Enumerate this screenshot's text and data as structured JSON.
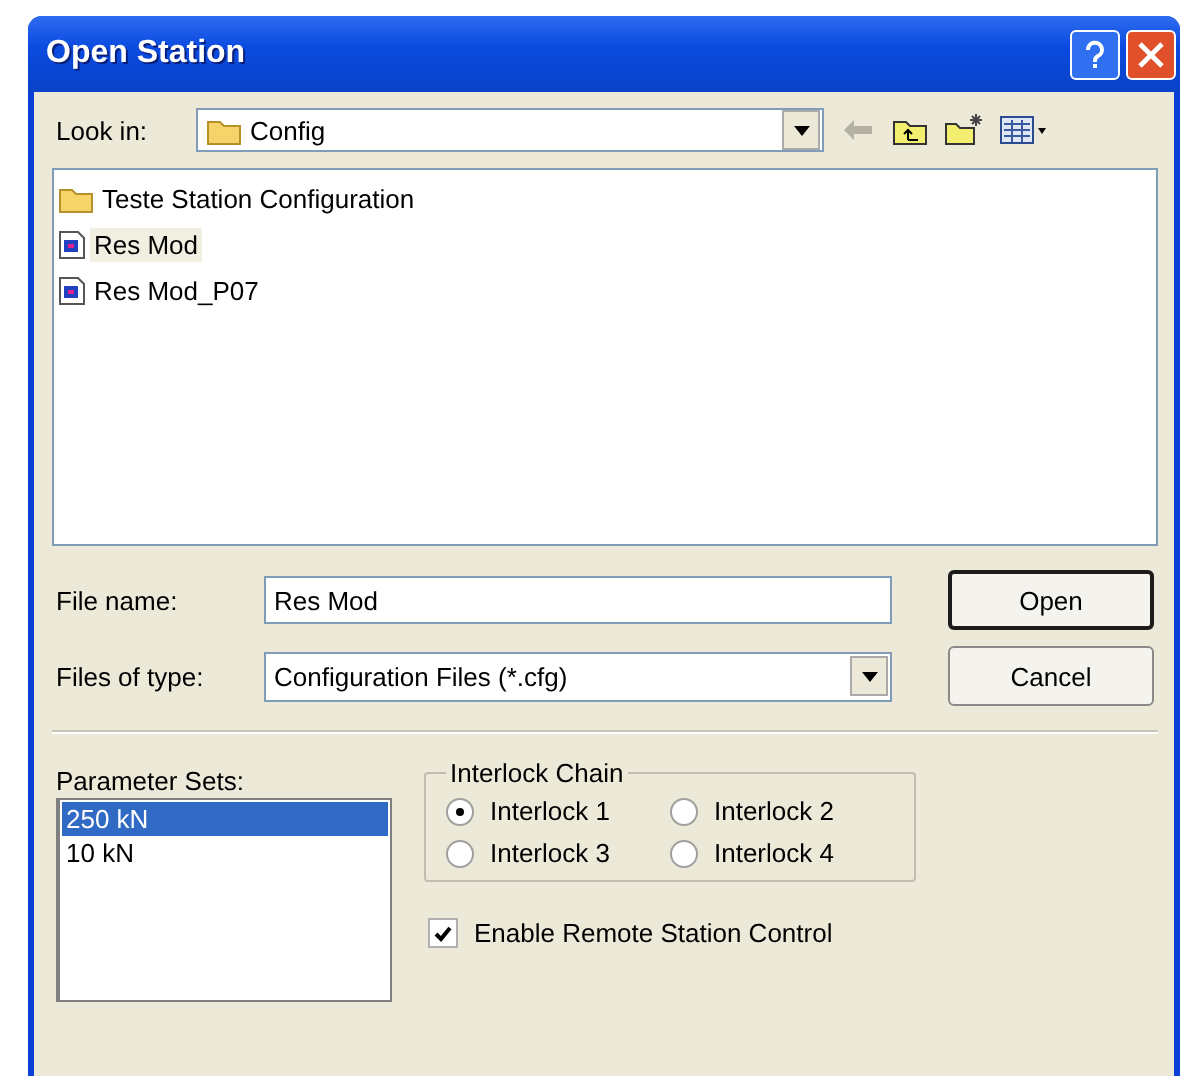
{
  "window": {
    "title": "Open Station"
  },
  "look_in": {
    "label": "Look in:",
    "value": "Config"
  },
  "files": [
    {
      "kind": "folder",
      "name": "Teste Station Configuration",
      "selected": false
    },
    {
      "kind": "file",
      "name": "Res Mod",
      "selected": true
    },
    {
      "kind": "file",
      "name": "Res Mod_P07",
      "selected": false
    }
  ],
  "file_name": {
    "label": "File name:",
    "value": "Res Mod"
  },
  "file_type": {
    "label": "Files of type:",
    "value": "Configuration Files (*.cfg)"
  },
  "buttons": [
    {
      "kind": "default",
      "label": "Open"
    },
    {
      "kind": "normal",
      "label": "Cancel"
    }
  ],
  "parameter_sets": {
    "label": "Parameter Sets:",
    "items": [
      {
        "name": "250 kN",
        "selected": true
      },
      {
        "name": "10 kN",
        "selected": false
      }
    ]
  },
  "interlock_chain": {
    "title": "Interlock Chain",
    "options": [
      {
        "label": "Interlock 1",
        "selected": true
      },
      {
        "label": "Interlock 2",
        "selected": false
      },
      {
        "label": "Interlock 3",
        "selected": false
      },
      {
        "label": "Interlock 4",
        "selected": false
      }
    ]
  },
  "remote_control": {
    "label": "Enable Remote Station Control",
    "checked": true
  }
}
